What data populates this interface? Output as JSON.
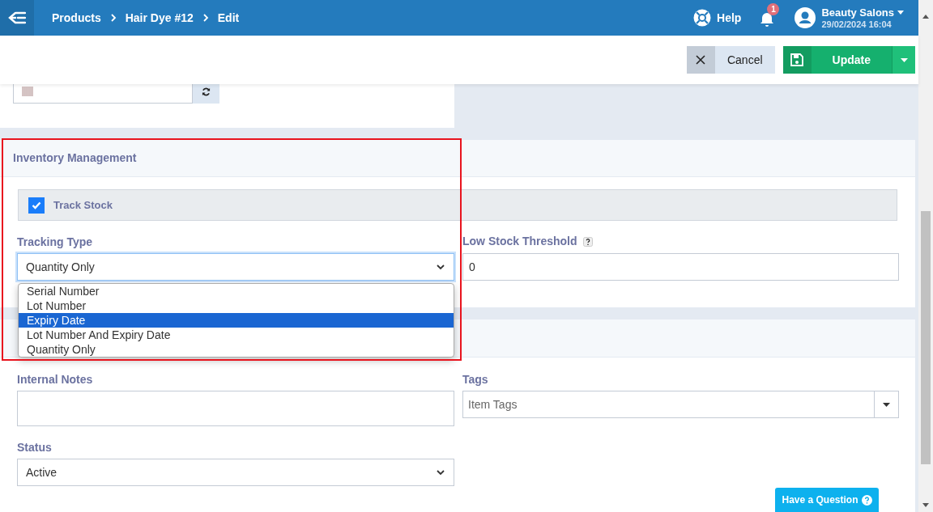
{
  "topbar": {
    "breadcrumbs": [
      "Products",
      "Hair Dye #12",
      "Edit"
    ],
    "help": "Help",
    "notification_count": "1",
    "user": {
      "name": "Beauty Salons",
      "datetime": "29/02/2024 16:04"
    }
  },
  "actions": {
    "cancel": "Cancel",
    "update": "Update"
  },
  "inventory": {
    "title": "Inventory Management",
    "track_stock": {
      "label": "Track Stock",
      "checked": true
    },
    "tracking_type": {
      "label": "Tracking Type",
      "value": "Quantity Only",
      "expanded": true,
      "options": [
        {
          "label": "Serial Number",
          "highlighted": false
        },
        {
          "label": "Lot Number",
          "highlighted": false
        },
        {
          "label": "Expiry Date",
          "highlighted": true
        },
        {
          "label": "Lot Number And Expiry Date",
          "highlighted": false
        },
        {
          "label": "Quantity Only",
          "highlighted": false
        }
      ]
    },
    "low_stock": {
      "label": "Low Stock Threshold",
      "value": "0"
    }
  },
  "more": {
    "internal_notes": {
      "label": "Internal Notes"
    },
    "tags": {
      "label": "Tags",
      "placeholder": "Item Tags"
    },
    "status": {
      "label": "Status",
      "value": "Active"
    }
  },
  "help_button": "Have a Question"
}
